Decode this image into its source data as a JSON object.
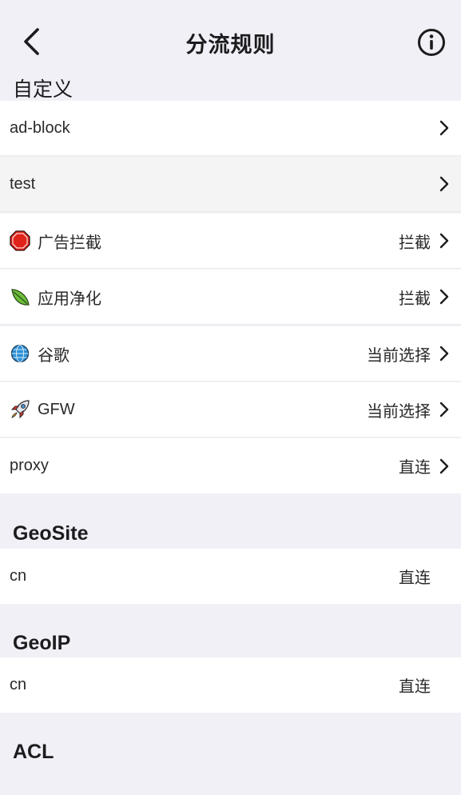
{
  "header": {
    "title": "分流规则",
    "back_icon": "chevron-left-icon",
    "info_icon": "info-circle-icon"
  },
  "sections": {
    "custom": {
      "title": "自定义",
      "rows": [
        {
          "label": "ad-block",
          "value": ""
        },
        {
          "label": "test",
          "value": ""
        },
        {
          "label": "广告拦截",
          "value": "拦截",
          "icon": "stop-sign-icon"
        },
        {
          "label": "应用净化",
          "value": "拦截",
          "icon": "leaf-icon"
        },
        {
          "label": "谷歌",
          "value": "当前选择",
          "icon": "globe-icon"
        },
        {
          "label": "GFW",
          "value": "当前选择",
          "icon": "rocket-icon"
        },
        {
          "label": "proxy",
          "value": "直连"
        }
      ]
    },
    "geosite": {
      "title": "GeoSite",
      "rows": [
        {
          "label": "cn",
          "value": "直连"
        }
      ]
    },
    "geoip": {
      "title": "GeoIP",
      "rows": [
        {
          "label": "cn",
          "value": "直连"
        }
      ]
    },
    "acl": {
      "title": "ACL"
    }
  },
  "colors": {
    "background": "#f1f0f6",
    "row_background": "#ffffff",
    "row_selected": "#f4f4f4",
    "stop_red": "#e0241b",
    "leaf_green": "#6cbf3a",
    "globe_blue": "#2a8fd8",
    "rocket_red": "#d8342a"
  }
}
